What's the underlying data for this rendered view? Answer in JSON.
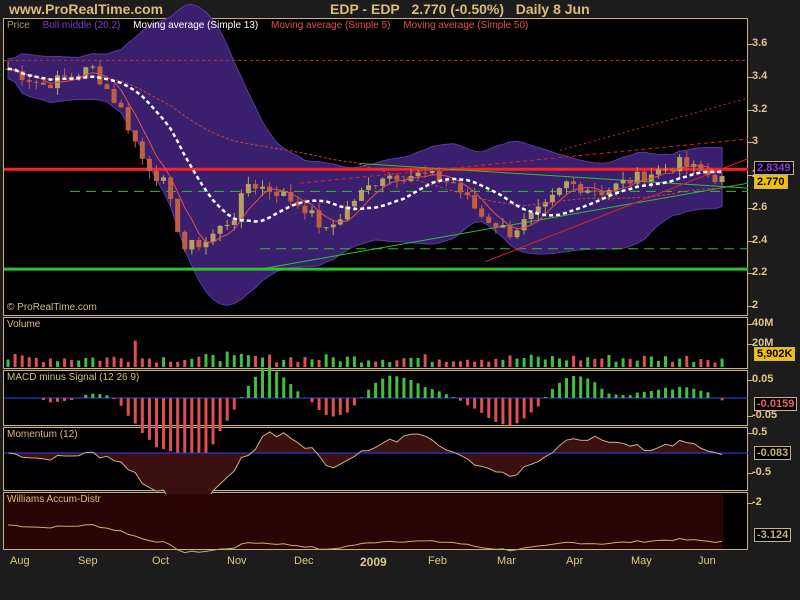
{
  "header": {
    "site": "www.ProRealTime.com",
    "instrument": "EDP - EDP",
    "price": "2.770 (-0.50%)",
    "period": "Daily 8 Jun"
  },
  "price_panel": {
    "legend": [
      "Price",
      "Boll middle (20,2)",
      "Moving average (Simple 13)",
      "Moving average (Simple 5)",
      "Moving average (Simple 50)"
    ],
    "legend_colors": [
      "#b0a060",
      "#7a3cc8",
      "#ffffff",
      "#e05050",
      "#e05050"
    ],
    "watermark": "© ProRealTime.com",
    "axis": [
      "3.6",
      "3.4",
      "3.2",
      "3",
      "2.8",
      "2.6",
      "2.4",
      "2.2",
      "2"
    ],
    "boll_tag": "2.8349",
    "last_tag": "2.770",
    "price_keypoints": [
      [
        0,
        3.45
      ],
      [
        5,
        3.35
      ],
      [
        12,
        3.45
      ],
      [
        16,
        3.2
      ],
      [
        19,
        2.9
      ],
      [
        22,
        2.75
      ],
      [
        25,
        2.35
      ],
      [
        28,
        2.4
      ],
      [
        32,
        2.55
      ],
      [
        34,
        2.75
      ],
      [
        38,
        2.7
      ],
      [
        42,
        2.6
      ],
      [
        45,
        2.45
      ],
      [
        49,
        2.65
      ],
      [
        53,
        2.8
      ],
      [
        59,
        2.8
      ],
      [
        63,
        2.75
      ],
      [
        67,
        2.55
      ],
      [
        71,
        2.45
      ],
      [
        76,
        2.6
      ],
      [
        79,
        2.75
      ],
      [
        84,
        2.7
      ],
      [
        90,
        2.8
      ],
      [
        95,
        2.87
      ],
      [
        101,
        2.77
      ]
    ]
  },
  "volume": {
    "title": "Volume",
    "axis": [
      "40M",
      "20M"
    ],
    "last": "5,902K"
  },
  "macd": {
    "title": "MACD minus Signal (12 26 9)",
    "axis": [
      "0.05",
      "-0.05"
    ],
    "last": "-0.0159"
  },
  "momentum": {
    "title": "Momentum (12)",
    "axis": [
      "0.5",
      "-0.5"
    ],
    "last": "-0.083"
  },
  "williams": {
    "title": "Williams Accum-Distr",
    "axis": [
      "-2"
    ],
    "last": "-3.124"
  },
  "xaxis": [
    "Aug",
    "Sep",
    "Oct",
    "Nov",
    "Dec",
    "2009",
    "Feb",
    "Mar",
    "Apr",
    "May",
    "Jun"
  ]
}
